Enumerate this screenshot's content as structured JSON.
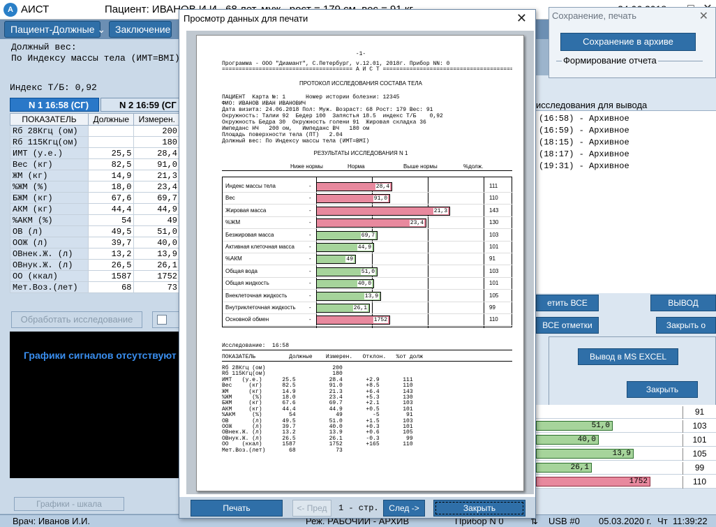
{
  "main_window": {
    "app_title": "АИСТ",
    "patient_label": "Пациент:  ИВАНОВ И.И.,  68 лет, муж., рост = 179 см, вес = 91 кг",
    "date_fragment": "ь: 24.06.2018"
  },
  "toolbar": {
    "patient_due": "Пациент-Должные",
    "conclusion": "Заключение"
  },
  "main": {
    "due_weight_label": "Должный вес:",
    "due_weight_value": "По Индексу массы тела (ИМТ=BMI)",
    "index_tb": "Индекс Т/Б:  0,92",
    "tabs": [
      {
        "label": "N 1  16:58 (СГ)"
      },
      {
        "label": "N 2  16:59 (СГ"
      }
    ],
    "grid_headers": [
      "ПОКАЗАТЕЛЬ",
      "Должные",
      "Измерен."
    ],
    "grid_rows": [
      {
        "label": "Rб 28Кгц (ом)",
        "due": "",
        "meas": "200"
      },
      {
        "label": "Rб 115Кгц(ом)",
        "due": "",
        "meas": "180"
      },
      {
        "label": "ИМТ    (у.е.)",
        "due": "25,5",
        "meas": "28,4"
      },
      {
        "label": "Вес      (кг)",
        "due": "82,5",
        "meas": "91,0"
      },
      {
        "label": "ЖМ       (кг)",
        "due": "14,9",
        "meas": "21,3"
      },
      {
        "label": "%ЖМ       (%)",
        "due": "18,0",
        "meas": "23,4"
      },
      {
        "label": "БЖМ      (кг)",
        "due": "67,6",
        "meas": "69,7"
      },
      {
        "label": "АКМ      (кг)",
        "due": "44,4",
        "meas": "44,9"
      },
      {
        "label": "%АКМ      (%)",
        "due": "54",
        "meas": "49"
      },
      {
        "label": "ОВ        (л)",
        "due": "49,5",
        "meas": "51,0"
      },
      {
        "label": "ООЖ       (л)",
        "due": "39,7",
        "meas": "40,0"
      },
      {
        "label": "ОВнек.Ж.  (л)",
        "due": "13,2",
        "meas": "13,9"
      },
      {
        "label": "ОВнук.Ж.  (л)",
        "due": "26,5",
        "meas": "26,1"
      },
      {
        "label": "ОО     (ккал)",
        "due": "1587",
        "meas": "1752"
      },
      {
        "label": "Мет.Воз.(лет)",
        "due": "68",
        "meas": "73"
      }
    ],
    "process_button": "Обработать исследование",
    "no_signals": "Графики сигналов отсутствуют",
    "graph_button": "Графики - шкала"
  },
  "statusbar": {
    "doctor": "Врач: Иванов И.И.",
    "mode": "Реж. РАБОЧИЙ - АРХИВ",
    "device": "Прибор N 0",
    "usb": "USB #0",
    "date": "05.03.2020 г.",
    "weekday": "Чт",
    "time": "11:39:22"
  },
  "save_dialog": {
    "title": "Сохранение, печать",
    "save_archive": "Сохранение в архиве",
    "form_report": "Формирование отчета"
  },
  "right_panel": {
    "list_title": "исследования для вывода",
    "items": [
      {
        "time": "(16:58)",
        "status": "Архивное"
      },
      {
        "time": "(16:59)",
        "status": "Архивное"
      },
      {
        "time": "(18:15)",
        "status": "Архивное"
      },
      {
        "time": "(18:17)",
        "status": "Архивное"
      },
      {
        "time": "(19:31)",
        "status": "Архивное"
      }
    ],
    "print_all": "етить ВСЕ",
    "output": "ВЫВОД",
    "all_marks": "ВСЕ отметки",
    "close_frag": "Закрыть о",
    "excel": "Вывод в MS EXCEL",
    "close": "Закрыть",
    "bg_rows": [
      {
        "value": "",
        "pct": "91",
        "fill": 0.0
      },
      {
        "value": "51,0",
        "pct": "103",
        "fill": 0.55
      },
      {
        "value": "40,0",
        "pct": "101",
        "fill": 0.45
      },
      {
        "value": "13,9",
        "pct": "105",
        "fill": 0.7
      },
      {
        "value": "26,1",
        "pct": "99",
        "fill": 0.4
      },
      {
        "value": "1752",
        "pct": "110",
        "fill": 0.82
      }
    ]
  },
  "print_preview": {
    "title": "Просмотр данных для печати",
    "page_num": "-1-",
    "program_line": "Программа - ООО \"Диамант\", С.Петербург, v.12.01, 2018г. Прибор NN: 0",
    "rule_line": "======================================= А И С Т =======================================",
    "protocol_title": "ПРОТОКОЛ ИССЛЕДОВАНИЯ СОСТАВА ТЕЛА",
    "patient_lines": [
      "ПАЦИЕНТ  Карта №: 1      Номер истории болезни: 12345",
      "ФИО: ИВАНОВ ИВАН ИВАНОВИЧ",
      "Дата визита: 24.06.2018 Пол: Муж. Возраст: 68 Рост: 179 Вес: 91",
      "Окружность: Талии 92  Бедер 100  Запястья 18.5  индекс Т/Б    0,92",
      "Окружность Бедра 30  Окружность голени 91  Жировая складка 36",
      "Импеданс НЧ   200 ом,   Импеданс ВЧ   180 ом",
      "Площадь поверхности тела (ПТ)   2.04",
      "Должный вес: По Индексу массы тела (ИМТ=BMI)"
    ],
    "results_title": "РЕЗУЛЬТАТЫ ИССЛЕДОВАНИЯ   N 1",
    "chart_headers": {
      "below": "Ниже нормы",
      "norm": "Норма",
      "above": "Выше нормы",
      "pct": "%долж."
    },
    "study_line": "Исследование:  16:58",
    "table_headers": "ПОКАЗАТЕЛЬ          Должные    Измерен.   Отклон.   %от долж",
    "table_rows": [
      "Rб 28Кгц (ом)                    200",
      "Rб 115Кгц(ом)                    180",
      "ИМТ   (у.е.)      25.5          28.4       +2.9       111",
      "Вес     (кг)      82.5          91.0       +8.5       110",
      "ЖМ      (кг)      14.9          21.3       +6.4       143",
      "%ЖМ      (%)      18.0          23.4       +5.3       130",
      "БЖМ     (кг)      67.6          69.7       +2.1       103",
      "АКМ     (кг)      44.4          44.9       +0.5       101",
      "%АКМ     (%)        54            49         -5        91",
      "ОВ       (л)      49.5          51.0       +1.5       103",
      "ООЖ      (л)      39.7          40.0       +0.3       101",
      "ОВнек.Ж. (л)      13.2          13.9       +0.6       105",
      "ОВнук.Ж. (л)      26.5          26.1       -0.3        99",
      "ОО    (ккал)      1587          1752       +165       110",
      "Мет.Воз.(лет)       68            73"
    ],
    "buttons": {
      "print": "Печать",
      "prev": "<- Пред",
      "page_info": "1 - стр.",
      "next": "След ->",
      "close": "Закрыть"
    }
  },
  "chart_data": {
    "type": "bar",
    "title": "РЕЗУЛЬТАТЫ ИССЛЕДОВАНИЯ   N 1",
    "categories": [
      "Индекс массы тела",
      "Вес",
      "Жировая масса",
      "%ЖМ",
      "Безжировая масса",
      "Активная клеточная масса",
      "%АКМ",
      "Общая вода",
      "Общая жидкость",
      "Внеклеточная жидкость",
      "Внутриклеточная жидкость",
      "Основной обмен"
    ],
    "values": [
      "28,4",
      "91,0",
      "21,3",
      "23,4",
      "69,7",
      "44,9",
      "49",
      "51,0",
      "40,0",
      "13,9",
      "26,1",
      "1752"
    ],
    "pct_of_due": [
      111,
      110,
      143,
      130,
      103,
      101,
      91,
      103,
      101,
      105,
      99,
      110
    ],
    "colors": {
      "above_norm": "#e8899e",
      "norm": "#a6d49b"
    }
  }
}
